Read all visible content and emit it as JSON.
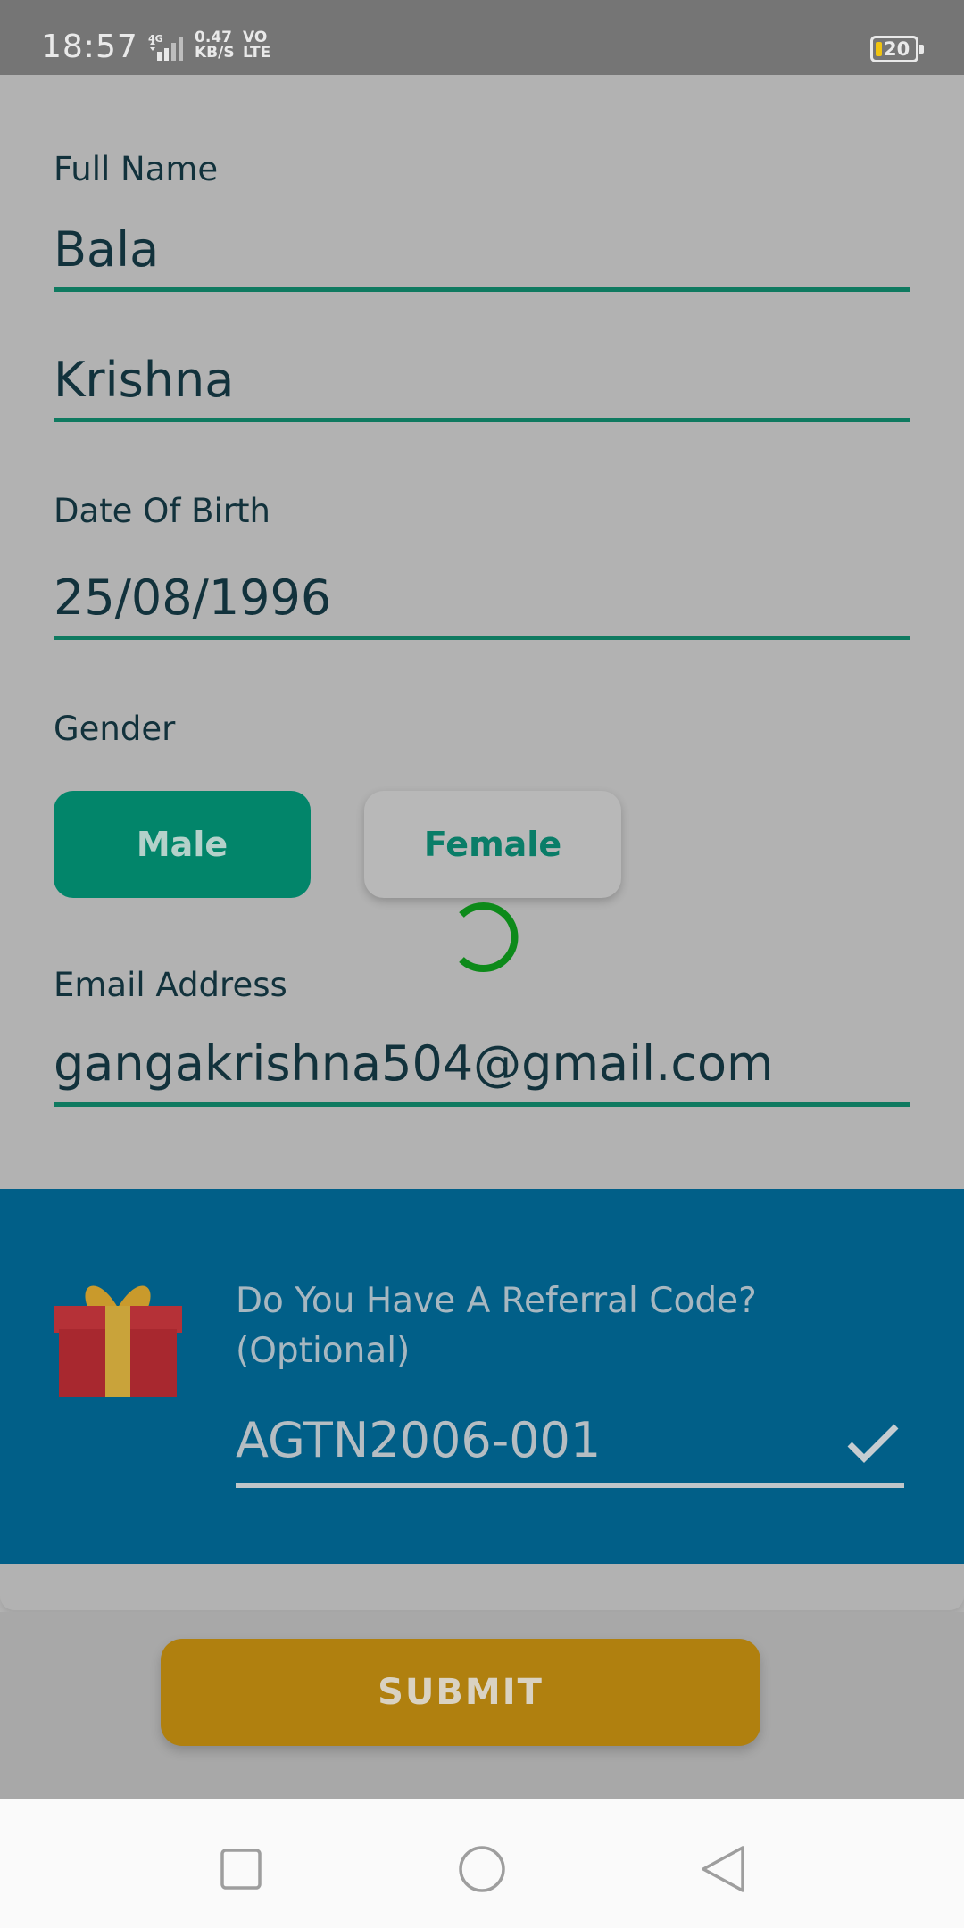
{
  "status_bar": {
    "time": "18:57",
    "network": "4G",
    "speed_value": "0.47",
    "speed_unit": "KB/S",
    "volte_top": "VO",
    "volte_bottom": "LTE",
    "battery": "20"
  },
  "form": {
    "full_name_label": "Full Name",
    "first_name": "Bala",
    "last_name": "Krishna",
    "dob_label": "Date Of Birth",
    "dob": "25/08/1996",
    "gender_label": "Gender",
    "gender_options": [
      "Male",
      "Female"
    ],
    "gender_selected": "Male",
    "email_label": "Email Address",
    "email": "gangakrishna504@gmail.com"
  },
  "referral": {
    "question": "Do You Have A Referral Code?",
    "optional": "(Optional)",
    "code": "AGTN2006-001"
  },
  "submit_label": "SUBMIT",
  "colors": {
    "accent_green": "#02856a",
    "referral_bg": "#015f88",
    "submit_bg": "#b0800f",
    "spinner": "#0d8a1a"
  }
}
